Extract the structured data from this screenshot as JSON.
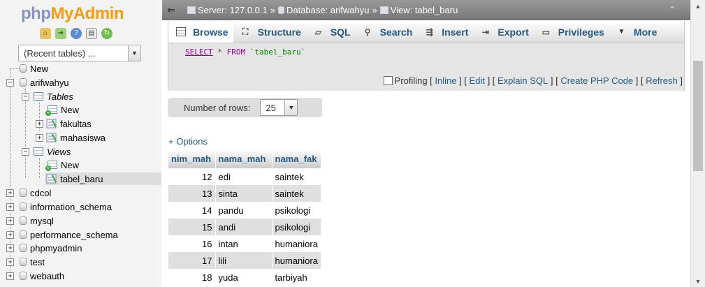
{
  "app": {
    "logo_php": "php",
    "logo_my": "My",
    "logo_admin": "Admin"
  },
  "nav": {
    "recent_tables": "(Recent tables) ...",
    "tree": {
      "new": "New",
      "db_arifwahyu": "arifwahyu",
      "tables_label": "Tables",
      "tables_new": "New",
      "table_fakultas": "fakultas",
      "table_mahasiswa": "mahasiswa",
      "views_label": "Views",
      "views_new": "New",
      "view_tabel_baru": "tabel_baru",
      "db_cdcol": "cdcol",
      "db_information_schema": "information_schema",
      "db_mysql": "mysql",
      "db_performance_schema": "performance_schema",
      "db_phpmyadmin": "phpmyadmin",
      "db_test": "test",
      "db_webauth": "webauth"
    }
  },
  "breadcrumb": {
    "server": "Server: 127.0.0.1",
    "database": "Database: arifwahyu",
    "view": "View: tabel_baru",
    "sep": "»"
  },
  "tabs": [
    "Browse",
    "Structure",
    "SQL",
    "Search",
    "Insert",
    "Export",
    "Privileges",
    "More"
  ],
  "sql": {
    "select": "SELECT",
    "star": " * ",
    "from": "FROM",
    "table": " `tabel_baru`"
  },
  "sql_links": {
    "profiling": "Profiling",
    "inline": "Inline",
    "edit": "Edit",
    "explain": "Explain SQL",
    "create_php": "Create PHP Code",
    "refresh": "Refresh"
  },
  "rows": {
    "label": "Number of rows:",
    "value": "25"
  },
  "options_link": "+ Options",
  "table": {
    "headers": [
      "nim_mah",
      "nama_mah",
      "nama_fak"
    ],
    "rows": [
      [
        "12",
        "edi",
        "saintek"
      ],
      [
        "13",
        "sinta",
        "saintek"
      ],
      [
        "14",
        "pandu",
        "psikologi"
      ],
      [
        "15",
        "andi",
        "psikologi"
      ],
      [
        "16",
        "intan",
        "humaniora"
      ],
      [
        "17",
        "lili",
        "humaniora"
      ],
      [
        "18",
        "yuda",
        "tarbiyah"
      ]
    ]
  },
  "icons": {
    "home": "home-icon",
    "logout": "logout-icon",
    "help": "help-icon",
    "docs": "docs-icon",
    "reload": "reload-icon"
  },
  "colors": {
    "link": "#235a81",
    "topbar": "#888888",
    "row_alt": "#dfdfdf",
    "logo_php": "#8892bf",
    "logo_myadmin": "#f89c0e"
  }
}
